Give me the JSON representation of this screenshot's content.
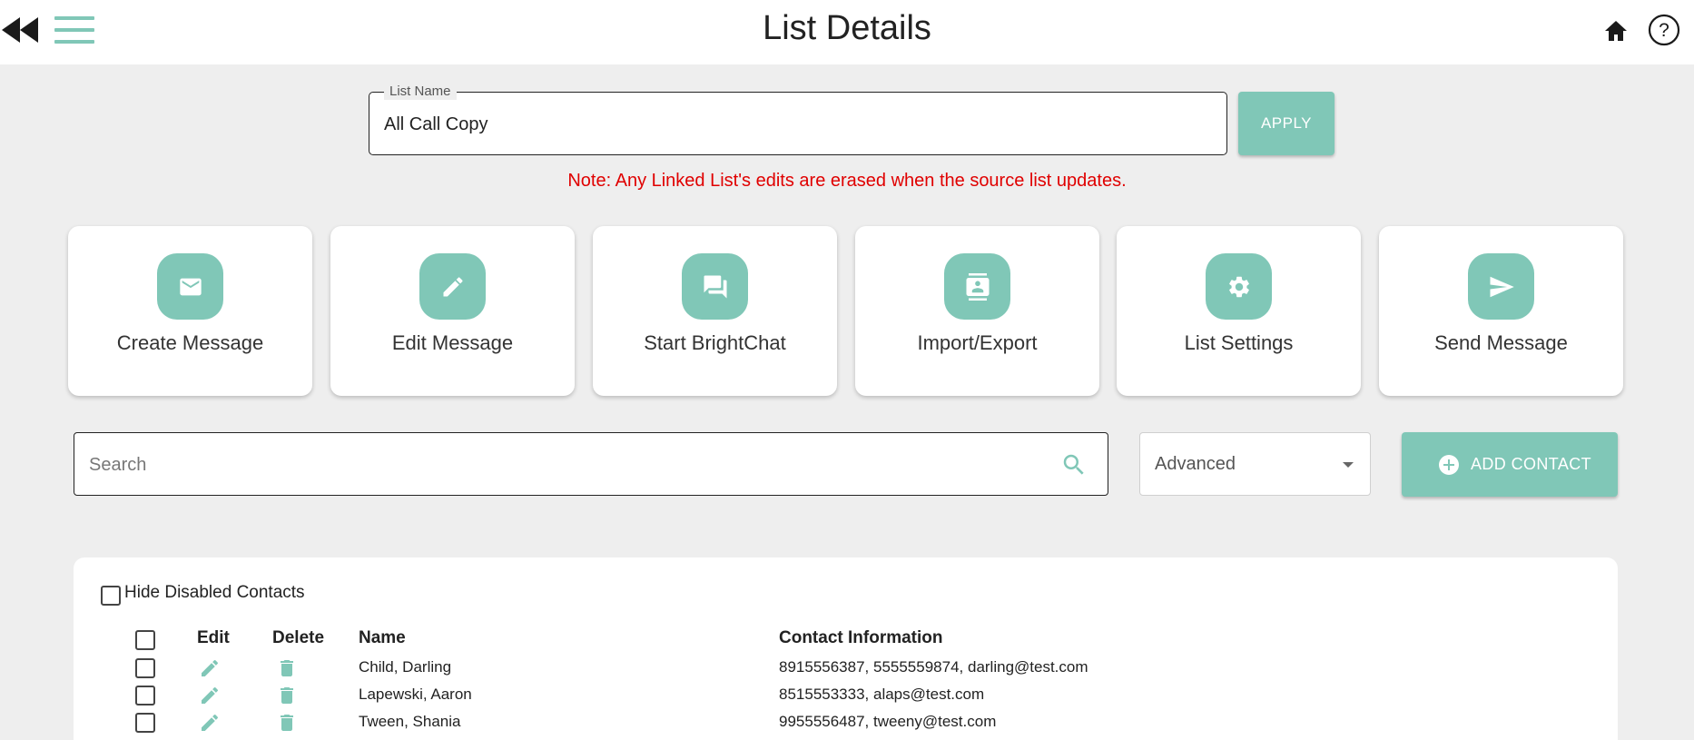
{
  "header": {
    "title": "List Details",
    "back_icon": "double-chevron-left-icon",
    "menu_icon": "hamburger-menu-icon",
    "home_icon": "home-icon",
    "help_icon": "help-circle-icon"
  },
  "list_name": {
    "label": "List Name",
    "value": "All Call Copy",
    "apply_label": "APPLY"
  },
  "note": "Note: Any Linked List's edits are erased when the source list updates.",
  "actions": [
    {
      "label": "Create Message",
      "icon": "envelope-icon"
    },
    {
      "label": "Edit Message",
      "icon": "pencil-icon"
    },
    {
      "label": "Start BrightChat",
      "icon": "chat-bubbles-icon"
    },
    {
      "label": "Import/Export",
      "icon": "contact-card-icon"
    },
    {
      "label": "List Settings",
      "icon": "gear-icon"
    },
    {
      "label": "Send Message",
      "icon": "send-icon"
    }
  ],
  "search": {
    "placeholder": "Search",
    "advanced_value": "Advanced",
    "add_contact_label": "ADD CONTACT"
  },
  "contacts": {
    "hide_disabled_label": "Hide Disabled Contacts",
    "columns": {
      "edit": "Edit",
      "delete": "Delete",
      "name": "Name",
      "contact_info": "Contact Information"
    },
    "rows": [
      {
        "name": "Child, Darling",
        "contact_info": "8915556387, 5555559874, darling@test.com"
      },
      {
        "name": "Lapewski, Aaron",
        "contact_info": "8515553333, alaps@test.com"
      },
      {
        "name": "Tween, Shania",
        "contact_info": "9955556487, tweeny@test.com"
      }
    ]
  },
  "colors": {
    "accent": "#80c7b7",
    "background": "#eeeeee",
    "note": "#e00000"
  }
}
